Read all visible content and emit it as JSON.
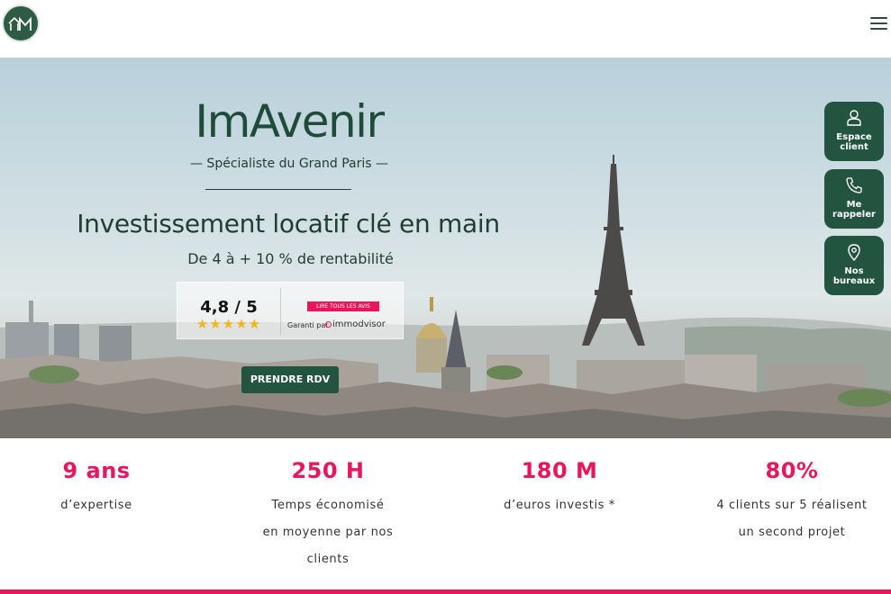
{
  "header": {
    "logo_icon": "house-logo-icon",
    "menu_icon": "hamburger-menu-icon"
  },
  "hero": {
    "brand": "ImAvenir",
    "tagline": "— Spécialiste du Grand Paris —",
    "headline": "Investissement locatif clé en main",
    "subline": "De 4 à + 10 % de rentabilité",
    "rating": {
      "score": "4,8 / 5",
      "stars": "★★★★★",
      "read_all": "LIRE TOUS LES AVIS",
      "garanti": "Garanti par",
      "provider": "immodvisor"
    },
    "cta": "PRENDRE RDV"
  },
  "side_buttons": [
    {
      "label": "Espace client",
      "line1": "Espace",
      "line2": "client",
      "icon": "user-icon"
    },
    {
      "label": "Me rappeler",
      "line1": "Me",
      "line2": "rappeler",
      "icon": "phone-icon"
    },
    {
      "label": "Nos bureaux",
      "line1": "Nos",
      "line2": "bureaux",
      "icon": "location-pin-icon"
    }
  ],
  "stats": [
    {
      "number": "9 ans",
      "lines": [
        "d’expertise"
      ]
    },
    {
      "number": "250 H",
      "lines": [
        "Temps économisé",
        "en moyenne par nos",
        "clients"
      ]
    },
    {
      "number": "180 M",
      "lines": [
        "d’euros investis *"
      ]
    },
    {
      "number": "80%",
      "lines": [
        "4 clients sur 5 réalisent",
        "un second projet"
      ]
    }
  ],
  "colors": {
    "brand_green": "#22543f",
    "accent_pink": "#e8175d",
    "star_gold": "#f3b51c"
  }
}
